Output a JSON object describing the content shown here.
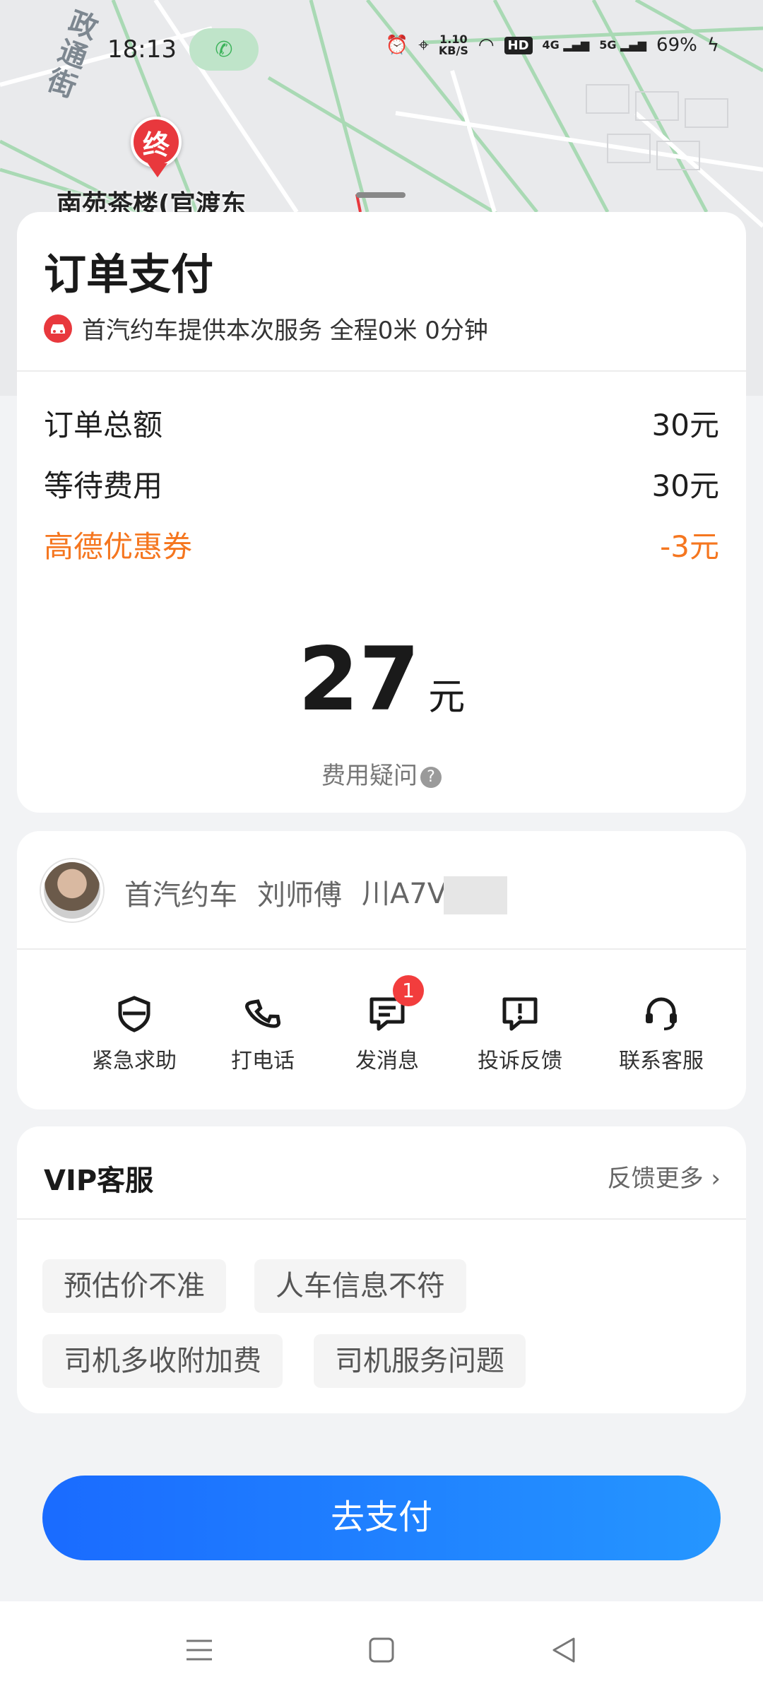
{
  "map": {
    "street_label": "政通街",
    "end_marker": "终",
    "place_name": "南苑茶楼(官渡东"
  },
  "status_bar": {
    "time": "18:13",
    "net_speed_top": "1.10",
    "net_speed_bottom": "KB/S",
    "hd": "HD",
    "sig1": "4G",
    "sig2": "5G",
    "battery": "69%"
  },
  "payment": {
    "title": "订单支付",
    "service_text": "首汽约车提供本次服务 全程0米 0分钟",
    "fees": [
      {
        "label": "订单总额",
        "value": "30元"
      },
      {
        "label": "等待费用",
        "value": "30元"
      }
    ],
    "coupon": {
      "label": "高德优惠券",
      "value": "-3元"
    },
    "total_amount": "27",
    "total_unit": "元",
    "fee_question": "费用疑问",
    "fee_question_icon": "?"
  },
  "driver": {
    "company": "首汽约车",
    "name": "刘师傅",
    "plate": "川A7V",
    "actions": [
      {
        "label": "紧急求助",
        "icon": "shield-icon"
      },
      {
        "label": "打电话",
        "icon": "phone-icon"
      },
      {
        "label": "发消息",
        "icon": "message-icon",
        "badge": "1"
      },
      {
        "label": "投诉反馈",
        "icon": "complaint-icon"
      },
      {
        "label": "联系客服",
        "icon": "headset-icon"
      }
    ]
  },
  "vip": {
    "title": "VIP客服",
    "more": "反馈更多",
    "tags": [
      "预估价不准",
      "人车信息不符",
      "司机多收附加费",
      "司机服务问题"
    ]
  },
  "pay_button": "去支付",
  "colors": {
    "accent_blue": "#1a6bff",
    "coupon_orange": "#f5761f",
    "marker_red": "#e8383d",
    "badge_red": "#f23d3d"
  }
}
